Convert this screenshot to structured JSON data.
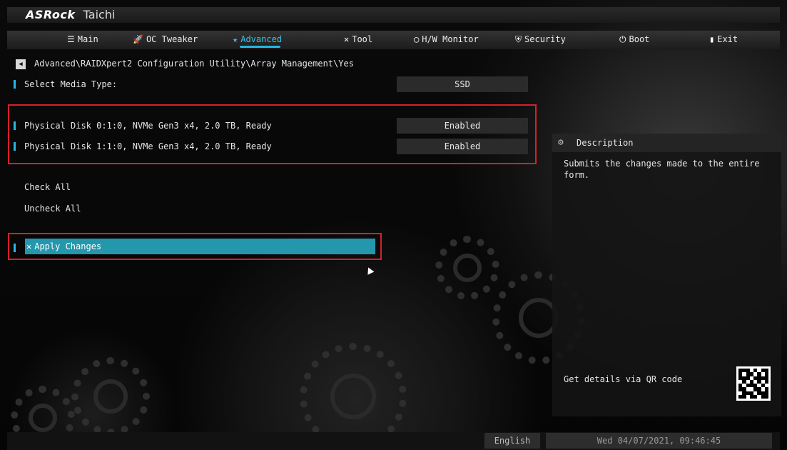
{
  "brand": {
    "name": "ASRock",
    "model": "Taichi"
  },
  "tabs": [
    {
      "label": "Main",
      "icon": "list-icon",
      "active": false
    },
    {
      "label": "OC Tweaker",
      "icon": "rocket-icon",
      "active": false
    },
    {
      "label": "Advanced",
      "icon": "star-icon",
      "active": true
    },
    {
      "label": "Tool",
      "icon": "tools-icon",
      "active": false
    },
    {
      "label": "H/W Monitor",
      "icon": "monitor-icon",
      "active": false
    },
    {
      "label": "Security",
      "icon": "shield-icon",
      "active": false
    },
    {
      "label": "Boot",
      "icon": "power-icon",
      "active": false
    },
    {
      "label": "Exit",
      "icon": "exit-icon",
      "active": false
    }
  ],
  "breadcrumb": "Advanced\\RAIDXpert2 Configuration Utility\\Array Management\\Yes",
  "media_type": {
    "label": "Select Media Type:",
    "value": "SSD"
  },
  "disks": [
    {
      "label": "Physical Disk 0:1:0, NVMe Gen3 x4, 2.0 TB, Ready",
      "value": "Enabled"
    },
    {
      "label": "Physical Disk 1:1:0, NVMe Gen3 x4, 2.0 TB, Ready",
      "value": "Enabled"
    }
  ],
  "actions": {
    "check_all": "Check All",
    "uncheck_all": "Uncheck All",
    "apply": "Apply Changes"
  },
  "description": {
    "title": "Description",
    "text": "Submits the changes made to the entire form.",
    "qr_label": "Get details via QR code"
  },
  "footer": {
    "language": "English",
    "datetime": "Wed 04/07/2021, 09:46:45"
  },
  "colors": {
    "accent": "#2bb6e3",
    "selection": "#2497ac",
    "highlight_box": "#d6202a"
  }
}
